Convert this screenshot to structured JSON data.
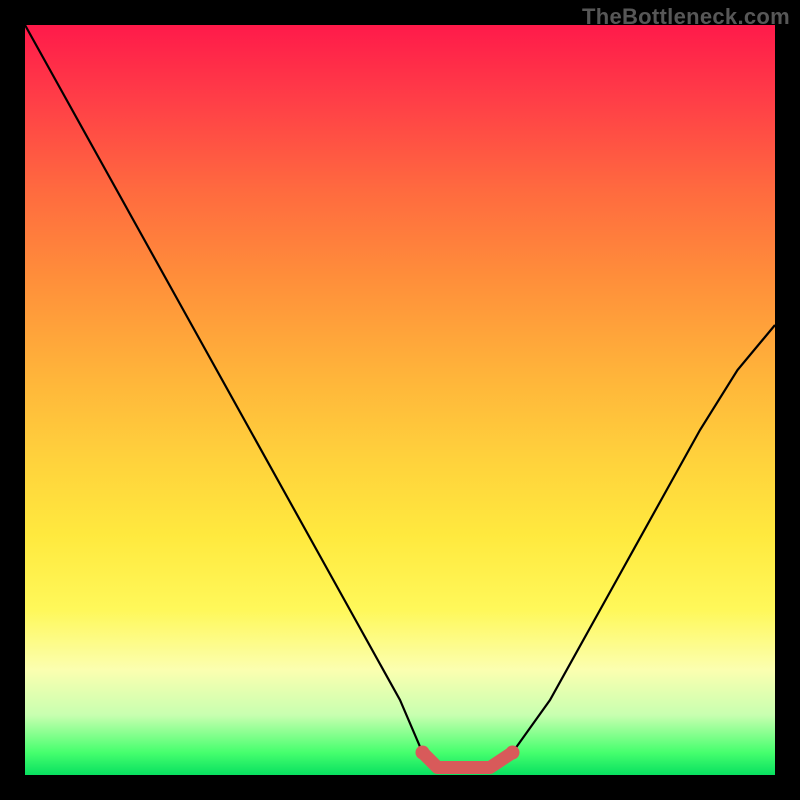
{
  "watermark": "TheBottleneck.com",
  "chart_data": {
    "type": "line",
    "title": "",
    "xlabel": "",
    "ylabel": "",
    "xlim": [
      0,
      100
    ],
    "ylim": [
      0,
      100
    ],
    "series": [
      {
        "name": "bottleneck-curve",
        "x": [
          0,
          5,
          10,
          15,
          20,
          25,
          30,
          35,
          40,
          45,
          50,
          53,
          55,
          58,
          62,
          65,
          70,
          75,
          80,
          85,
          90,
          95,
          100
        ],
        "values": [
          100,
          91,
          82,
          73,
          64,
          55,
          46,
          37,
          28,
          19,
          10,
          3,
          1,
          1,
          1,
          3,
          10,
          19,
          28,
          37,
          46,
          54,
          60
        ]
      },
      {
        "name": "optimal-band",
        "x": [
          53,
          55,
          58,
          62,
          65
        ],
        "values": [
          3,
          1,
          1,
          1,
          3
        ]
      }
    ]
  },
  "colors": {
    "curve": "#000000",
    "band": "#d85a5a"
  }
}
